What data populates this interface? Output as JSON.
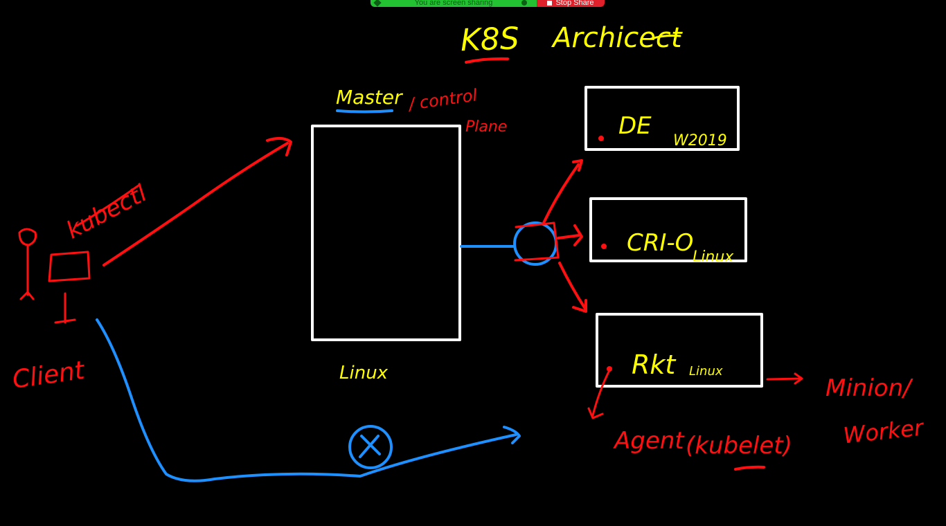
{
  "share_bar": {
    "status_label": "You are screen sharing",
    "stop_label": "Stop Share",
    "status_color": "#22c232",
    "stop_color": "#e0202a"
  },
  "whiteboard": {
    "background": "#000000",
    "ink_colors": {
      "yellow": "#ffff00",
      "red": "#ff1010",
      "blue": "#1e90ff",
      "white": "#ffffff"
    },
    "title": {
      "k8s": "K8S",
      "rest": "Archicect"
    },
    "master": {
      "label": "Master",
      "control": "/ control",
      "plane": "Plane",
      "os": "Linux"
    },
    "client": {
      "tool": "kubectl",
      "label": "Client"
    },
    "nodes": [
      {
        "runtime": "DE",
        "os": "W2019"
      },
      {
        "runtime": "CRI-O",
        "os": "Linux"
      },
      {
        "runtime": "Rkt",
        "os": "Linux"
      }
    ],
    "agent": {
      "label": "Agent",
      "kubelet": "(kubelet)"
    },
    "worker": {
      "minion": "Minion/",
      "worker": "Worker"
    }
  }
}
